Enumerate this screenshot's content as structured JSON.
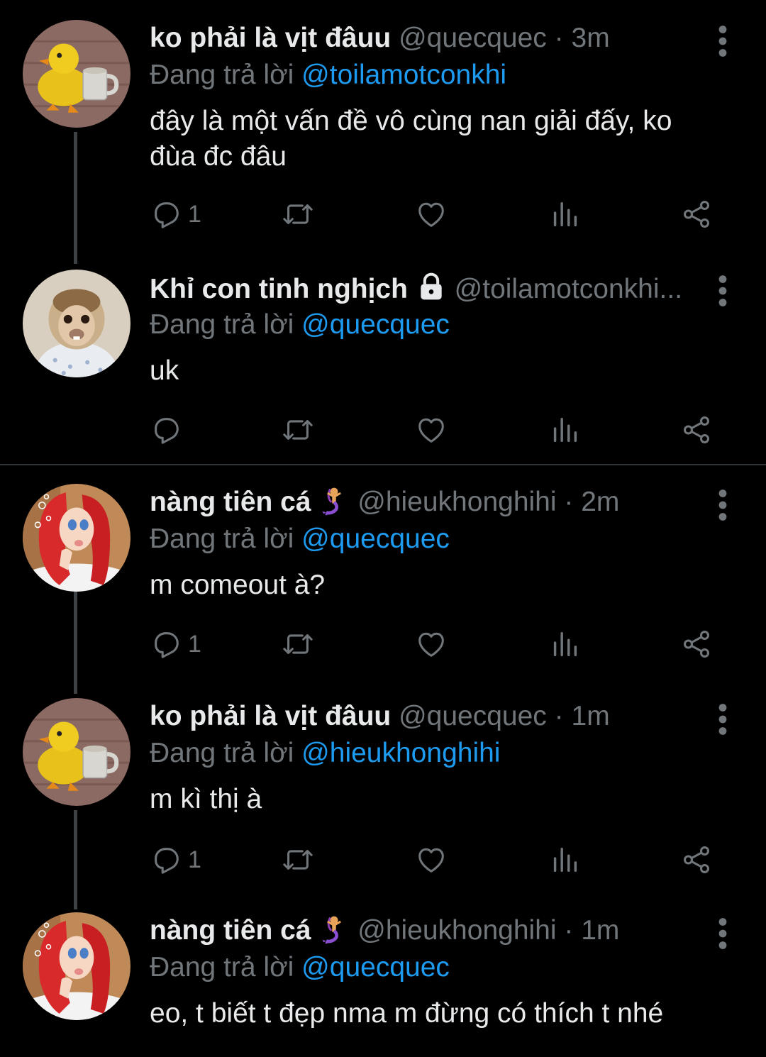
{
  "tweets": [
    {
      "name": "ko phải là vịt đâuu",
      "handle": "@quecquec",
      "dot": "·",
      "time": "3m",
      "reply_prefix": "Đang trả lời",
      "reply_to": "@toilamotconkhi",
      "text": "đây là một vấn đề vô cùng nan giải đấy, ko đùa đc đâu",
      "reply_count": "1",
      "avatar": "duck-avatar"
    },
    {
      "name": "Khỉ con tinh nghịch",
      "handle": "@toilamotconkhi...",
      "reply_prefix": "Đang trả lời",
      "reply_to": "@quecquec",
      "text": "uk",
      "reply_count": "",
      "avatar": "monkey-avatar",
      "protected": true
    },
    {
      "name": "nàng tiên cá",
      "handle": "@hieukhonghihi",
      "dot": "·",
      "time": "2m",
      "reply_prefix": "Đang trả lời",
      "reply_to": "@quecquec",
      "text": "m comeout à?",
      "reply_count": "1",
      "avatar": "mermaid-avatar"
    },
    {
      "name": "ko phải là vịt đâuu",
      "handle": "@quecquec",
      "dot": "·",
      "time": "1m",
      "reply_prefix": "Đang trả lời",
      "reply_to": "@hieukhonghihi",
      "text": "m kì thị à",
      "reply_count": "1",
      "avatar": "duck-avatar"
    },
    {
      "name": "nàng tiên cá",
      "handle": "@hieukhonghihi",
      "dot": "·",
      "time": "1m",
      "reply_prefix": "Đang trả lời",
      "reply_to": "@quecquec",
      "text": "eo, t biết t đẹp nma m đừng có thích t nhé",
      "avatar": "mermaid-avatar"
    }
  ],
  "colors": {
    "background": "#000000",
    "text": "#e7e9ea",
    "muted": "#71767b",
    "link": "#1d9bf0",
    "thread_line": "#3e4144"
  },
  "icons": [
    "reply-icon",
    "retweet-icon",
    "like-icon",
    "views-icon",
    "share-icon",
    "more-icon",
    "lock-icon",
    "mermaid-emoji"
  ]
}
